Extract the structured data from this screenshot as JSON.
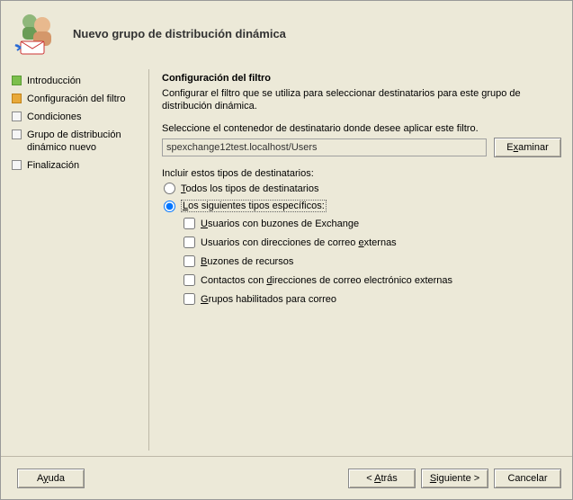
{
  "header": {
    "title": "Nuevo grupo de distribución dinámica"
  },
  "sidebar": {
    "steps": [
      {
        "label": "Introducción",
        "state": "done"
      },
      {
        "label": "Configuración del filtro",
        "state": "current"
      },
      {
        "label": "Condiciones",
        "state": "pending"
      },
      {
        "label": "Grupo de distribución dinámico nuevo",
        "state": "pending"
      },
      {
        "label": "Finalización",
        "state": "pending"
      }
    ]
  },
  "content": {
    "section_title": "Configuración del filtro",
    "section_desc": "Configurar el filtro que se utiliza para seleccionar destinatarios para este grupo de distribución dinámica.",
    "container_label": "Seleccione el contenedor de destinatario donde desee aplicar este filtro.",
    "container_value": "spexchange12test.localhost/Users",
    "browse_label": "Examinar",
    "include_label": "Incluir estos tipos de destinatarios:",
    "radio_all": "Todos los tipos de destinatarios",
    "radio_specific": "Los siguientes tipos específicos:",
    "checks": {
      "exchange": "Usuarios con buzones de Exchange",
      "external": "Usuarios con direcciones de correo externas",
      "resource": "Buzones de recursos",
      "contacts": "Contactos con direcciones de correo electrónico externas",
      "groups": "Grupos habilitados para correo"
    }
  },
  "footer": {
    "help": "Ayuda",
    "back": "< Atrás",
    "next": "Siguiente >",
    "cancel": "Cancelar"
  }
}
